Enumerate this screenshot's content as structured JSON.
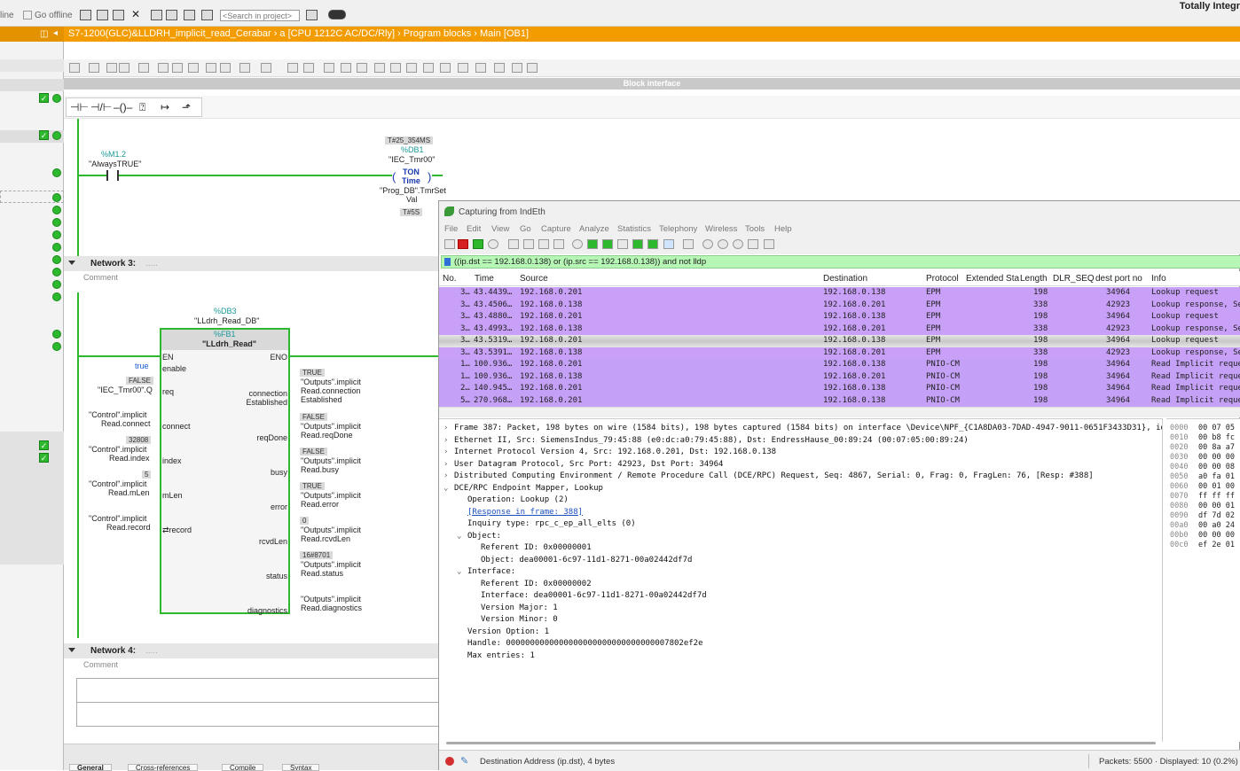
{
  "topbar": {
    "online": "line",
    "go_offline": "Go offline",
    "search_placeholder": "<Search in project>",
    "brand": "Totally Integr"
  },
  "breadcrumb": {
    "path": "S7-1200(GLC)&LLDRH_implicit_read_Cerabar  ›  a [CPU 1212C AC/DC/Rly]  ›  Program blocks  ›  Main [OB1]"
  },
  "editor": {
    "block_interface": "Block interface",
    "net2": {
      "contact_addr": "%M1.2",
      "contact_name": "\"AlwaysTRUE\"",
      "pt_val": "T#25_354MS",
      "db_addr": "%DB1",
      "db_name": "\"IEC_Tmr00\"",
      "ton": "TON",
      "time": "Time",
      "pt_src1": "\"Prog_DB\".TmrSet",
      "pt_src2": "Val",
      "et_val": "T#5S"
    },
    "net3": {
      "title": "Network 3:",
      "dots": ".....",
      "comment": "Comment",
      "db_addr": "%DB3",
      "db_name": "\"LLdrh_Read_DB\"",
      "fb_addr": "%FB1",
      "fb_name": "\"LLdrh_Read\"",
      "en": "EN",
      "eno": "ENO",
      "true_lbl": "true",
      "enable": "enable",
      "req_val": "FALSE",
      "req_src": "\"IEC_Tmr00\".Q",
      "req": "req",
      "connect_src1": "\"Control\".implicit",
      "connect_src2": "Read.connect",
      "connect": "connect",
      "index_val": "32808",
      "index_src1": "\"Control\".implicit",
      "index_src2": "Read.index",
      "index": "index",
      "mlen_val": "5",
      "mlen_src1": "\"Control\".implicit",
      "mlen_src2": "Read.mLen",
      "mlen": "mLen",
      "record_src1": "\"Control\".implicit",
      "record_src2": "Read.record",
      "record": "⇄record",
      "out_conn1": "connection",
      "out_conn2": "Established",
      "conn_val": "TRUE",
      "conn_dst1": "\"Outputs\".implicit",
      "conn_dst2": "Read.connection",
      "conn_dst3": "Established",
      "reqdone": "reqDone",
      "reqdone_val": "FALSE",
      "reqdone_dst1": "\"Outputs\".implicit",
      "reqdone_dst2": "Read.reqDone",
      "busy": "busy",
      "busy_val": "FALSE",
      "busy_dst1": "\"Outputs\".implicit",
      "busy_dst2": "Read.busy",
      "error": "error",
      "error_val": "TRUE",
      "error_dst1": "\"Outputs\".implicit",
      "error_dst2": "Read.error",
      "rcvdlen": "rcvdLen",
      "rcvdlen_val": "0",
      "rcvdlen_dst1": "\"Outputs\".implicit",
      "rcvdlen_dst2": "Read.rcvdLen",
      "status": "status",
      "status_val": "16#8701",
      "status_dst1": "\"Outputs\".implicit",
      "status_dst2": "Read.status",
      "diag": "diagnostics",
      "diag_dst1": "\"Outputs\".implicit",
      "diag_dst2": "Read.diagnostics"
    },
    "net4": {
      "title": "Network 4:",
      "dots": ".....",
      "comment": "Comment"
    },
    "bottom_tabs": [
      "General",
      "Cross-references",
      "Compile",
      "Syntax"
    ]
  },
  "wireshark": {
    "title": "Capturing from IndEth",
    "menu": [
      "File",
      "Edit",
      "View",
      "Go",
      "Capture",
      "Analyze",
      "Statistics",
      "Telephony",
      "Wireless",
      "Tools",
      "Help"
    ],
    "filter": "((ip.dst == 192.168.0.138) or (ip.src == 192.168.0.138))  and not lldp",
    "columns": [
      "No.",
      "Time",
      "Source",
      "Destination",
      "Protocol",
      "Extended Sta",
      "Length",
      "DLR_SEQ",
      "dest port no",
      "Info"
    ],
    "rows": [
      [
        "3…",
        "43.4439…",
        "192.168.0.201",
        "192.168.0.138",
        "EPM",
        "",
        "198",
        "",
        "34964",
        "Lookup request"
      ],
      [
        "3…",
        "43.4506…",
        "192.168.0.138",
        "192.168.0.201",
        "EPM",
        "",
        "338",
        "",
        "42923",
        "Lookup response, Se"
      ],
      [
        "3…",
        "43.4880…",
        "192.168.0.201",
        "192.168.0.138",
        "EPM",
        "",
        "198",
        "",
        "34964",
        "Lookup request"
      ],
      [
        "3…",
        "43.4993…",
        "192.168.0.138",
        "192.168.0.201",
        "EPM",
        "",
        "338",
        "",
        "42923",
        "Lookup response, Se"
      ],
      [
        "3…",
        "43.5319…",
        "192.168.0.201",
        "192.168.0.138",
        "EPM",
        "",
        "198",
        "",
        "34964",
        "Lookup request"
      ],
      [
        "3…",
        "43.5391…",
        "192.168.0.138",
        "192.168.0.201",
        "EPM",
        "",
        "338",
        "",
        "42923",
        "Lookup response, Se"
      ],
      [
        "1…",
        "100.936…",
        "192.168.0.201",
        "192.168.0.138",
        "PNIO-CM",
        "",
        "198",
        "",
        "34964",
        "Read Implicit reque"
      ],
      [
        "1…",
        "100.936…",
        "192.168.0.138",
        "192.168.0.201",
        "PNIO-CM",
        "",
        "198",
        "",
        "34964",
        "Read Implicit reque"
      ],
      [
        "2…",
        "140.945…",
        "192.168.0.201",
        "192.168.0.138",
        "PNIO-CM",
        "",
        "198",
        "",
        "34964",
        "Read Implicit reque"
      ],
      [
        "5…",
        "270.968…",
        "192.168.0.201",
        "192.168.0.138",
        "PNIO-CM",
        "",
        "198",
        "",
        "34964",
        "Read Implicit reque"
      ]
    ],
    "details": [
      "Frame 387: Packet, 198 bytes on wire (1584 bits), 198 bytes captured (1584 bits) on interface \\Device\\NPF_{C1A8DA03-7DAD-4947-9011-0651F3433D31}, id",
      "Ethernet II, Src: SiemensIndus_79:45:88 (e0:dc:a0:79:45:88), Dst: EndressHause_00:89:24 (00:07:05:00:89:24)",
      "Internet Protocol Version 4, Src: 192.168.0.201, Dst: 192.168.0.138",
      "User Datagram Protocol, Src Port: 42923, Dst Port: 34964",
      "Distributed Computing Environment / Remote Procedure Call (DCE/RPC) Request, Seq: 4867, Serial: 0, Frag: 0, FragLen: 76, [Resp: #388]",
      "DCE/RPC Endpoint Mapper, Lookup",
      "Operation: Lookup (2)",
      "[Response in frame: 388]",
      "Inquiry type: rpc_c_ep_all_elts (0)",
      "Object:",
      "Referent ID: 0x00000001",
      "Object: dea00001-6c97-11d1-8271-00a02442df7d",
      "Interface:",
      "Referent ID: 0x00000002",
      "Interface: dea00001-6c97-11d1-8271-00a02442df7d",
      "Version Major: 1",
      "Version Minor: 0",
      "Version Option: 1",
      "Handle: 0000000000000000000000000000000007802ef2e",
      "Max entries: 1"
    ],
    "hex": [
      [
        "0000",
        "00 07 05"
      ],
      [
        "0010",
        "00 b8 fc"
      ],
      [
        "0020",
        "00 8a a7"
      ],
      [
        "0030",
        "00 00 00"
      ],
      [
        "0040",
        "00 00 08"
      ],
      [
        "0050",
        "a0 fa 01"
      ],
      [
        "0060",
        "00 01 00"
      ],
      [
        "0070",
        "ff ff ff"
      ],
      [
        "0080",
        "00 00 01"
      ],
      [
        "0090",
        "df 7d 02"
      ],
      [
        "00a0",
        "00 a0 24"
      ],
      [
        "00b0",
        "00 00 00"
      ],
      [
        "00c0",
        "ef 2e 01"
      ]
    ],
    "status_left": "Destination Address (ip.dst), 4 bytes",
    "status_right": "Packets: 5500 · Displayed: 10 (0.2%)"
  },
  "colors": {
    "accent": "#f39c00",
    "rail": "#2eb82e",
    "row_bg": "#c8a0f8",
    "filter_bg": "#b6f7b6"
  }
}
